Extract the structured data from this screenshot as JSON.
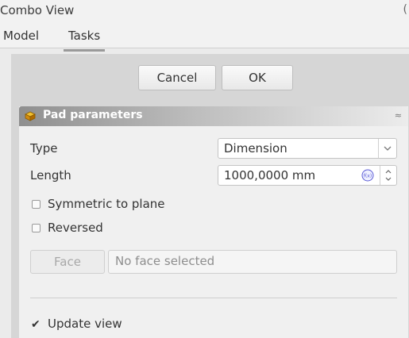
{
  "window": {
    "title": "Combo View",
    "edge_glyph": "("
  },
  "tabs": [
    {
      "label": "Model",
      "active": false
    },
    {
      "label": "Tasks",
      "active": true
    }
  ],
  "dialog_buttons": {
    "cancel": "Cancel",
    "ok": "OK"
  },
  "section": {
    "title": "Pad parameters",
    "icon": "pad-icon",
    "collapse_glyph": "≈"
  },
  "fields": {
    "type_label": "Type",
    "type_value": "Dimension",
    "type_arrow": "∨",
    "length_label": "Length",
    "length_value": "1000,0000 mm",
    "fx_icon_text": "f(x)"
  },
  "options": {
    "symmetric": {
      "label": "Symmetric to plane",
      "checked": false
    },
    "reversed": {
      "label": "Reversed",
      "checked": false
    },
    "update_view": {
      "label": "Update view",
      "checked": true,
      "mark": "✔"
    }
  },
  "face": {
    "button_label": "Face",
    "field_value": "No face selected"
  },
  "colors": {
    "panel_bg": "#d6d6d6",
    "section_bg": "#f0f0f0",
    "header_gradient_start": "#8f8f8f",
    "fx_icon": "#5b5bd6"
  }
}
